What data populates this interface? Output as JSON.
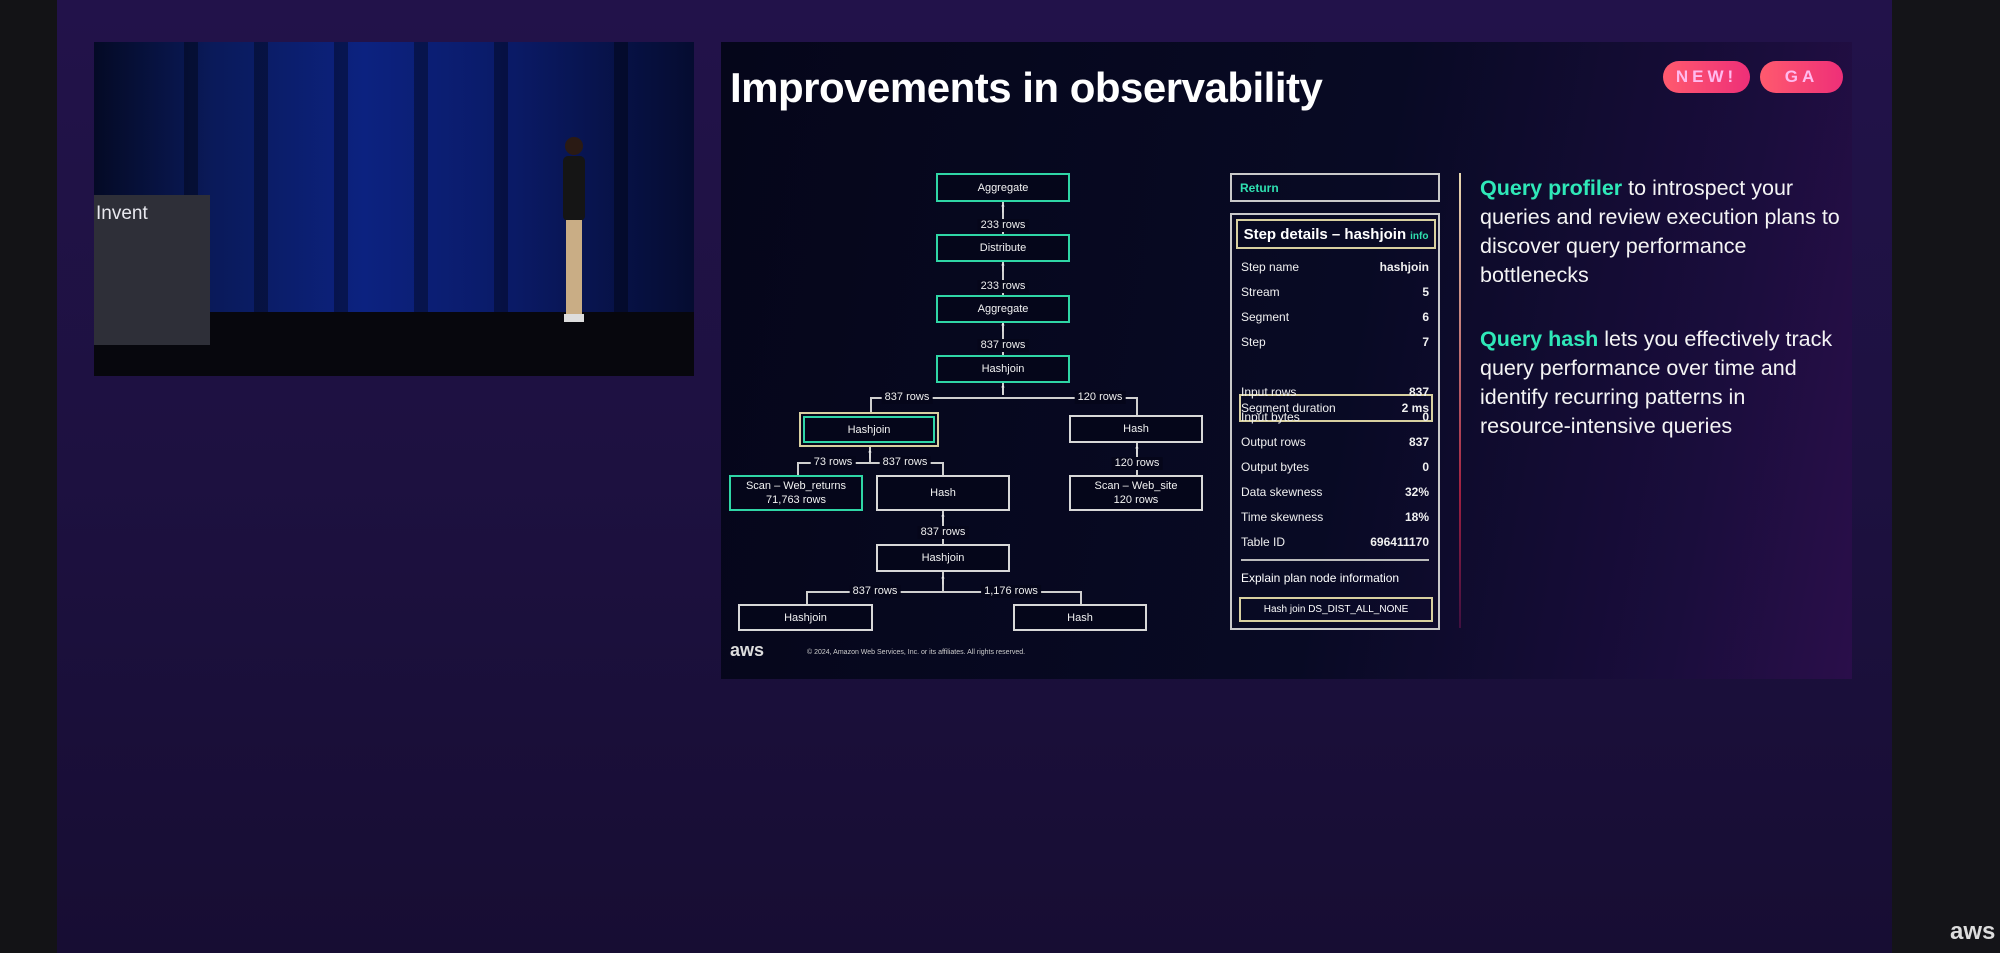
{
  "video": {
    "sign_text": "Invent"
  },
  "slide": {
    "title": "Improvements in observability",
    "badges": [
      "NEW!",
      "GA"
    ],
    "plan": {
      "nodes": {
        "aggregate_top": "Aggregate",
        "distribute": "Distribute",
        "aggregate_mid": "Aggregate",
        "hashjoin_top": "Hashjoin",
        "hashjoin_selected": "Hashjoin",
        "hash_right": "Hash",
        "scan_web_site": "Scan – Web_site",
        "scan_web_site_rows": "120 rows",
        "scan_web_returns": "Scan – Web_returns",
        "scan_web_returns_rows": "71,763 rows",
        "hash_mid": "Hash",
        "hashjoin_lower": "Hashjoin",
        "hashjoin_bottom": "Hashjoin",
        "hash_bottom": "Hash"
      },
      "edges": {
        "e1": "233 rows",
        "e2": "233 rows",
        "e3": "837 rows",
        "e4_left": "837 rows",
        "e4_right": "120 rows",
        "e5": "120 rows",
        "e6_left": "73 rows",
        "e6_right": "837 rows",
        "e7": "837 rows",
        "e8_left": "837 rows",
        "e8_right": "1,176 rows"
      }
    },
    "return_label": "Return",
    "details": {
      "title": "Step details – hashjoin",
      "info": "info",
      "rows": [
        {
          "label": "Step name",
          "value": "hashjoin"
        },
        {
          "label": "Stream",
          "value": "5"
        },
        {
          "label": "Segment",
          "value": "6"
        },
        {
          "label": "Step",
          "value": "7"
        },
        {
          "label": "Segment duration",
          "value": "2 ms"
        },
        {
          "label": "Input rows",
          "value": "837"
        },
        {
          "label": "Input bytes",
          "value": "0"
        },
        {
          "label": "Output rows",
          "value": "837"
        },
        {
          "label": "Output bytes",
          "value": "0"
        },
        {
          "label": "Data skewness",
          "value": "32%"
        },
        {
          "label": "Time skewness",
          "value": "18%"
        },
        {
          "label": "Table ID",
          "value": "696411170"
        }
      ],
      "explain_label": "Explain plan node information",
      "explain_value": "Hash join DS_DIST_ALL_NONE"
    },
    "bullets": [
      {
        "highlight": "Query profiler",
        "text": " to introspect your queries and review execution plans to discover query performance bottlenecks"
      },
      {
        "highlight": "Query hash",
        "text": " lets you effectively track query performance over time and identify recurring patterns in resource-intensive queries"
      }
    ],
    "footer": {
      "logo": "aws",
      "copyright": "© 2024, Amazon Web Services, Inc. or its affiliates. All rights reserved."
    }
  },
  "corner_logo": "aws",
  "colors": {
    "accent_teal": "#2fe8b8",
    "badge": "#f04a72",
    "background": "#1d1140"
  }
}
